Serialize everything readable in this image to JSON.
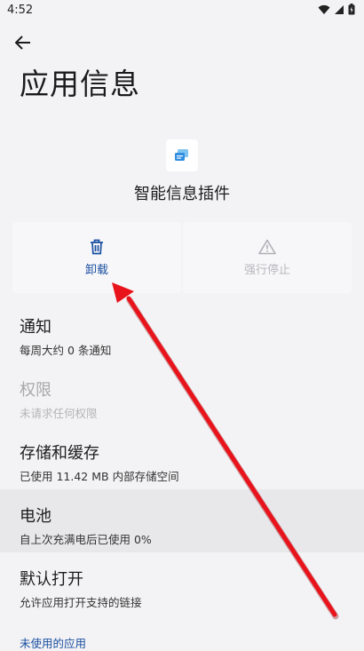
{
  "status": {
    "time": "4:52"
  },
  "header": {
    "title": "应用信息"
  },
  "app": {
    "name": "智能信息插件",
    "icon": "chat-bubbles-icon"
  },
  "actions": {
    "uninstall": {
      "label": "卸载",
      "icon": "trash-icon"
    },
    "force_stop": {
      "label": "强行停止",
      "icon": "warning-icon"
    }
  },
  "settings": {
    "items": [
      {
        "title": "通知",
        "subtitle": "每周大约 0 条通知"
      },
      {
        "title": "权限",
        "subtitle": "未请求任何权限"
      },
      {
        "title": "存储和缓存",
        "subtitle": "已使用 11.42 MB 内部存储空间"
      },
      {
        "title": "电池",
        "subtitle": "自上次充满电后已使用 0%"
      },
      {
        "title": "默认打开",
        "subtitle": "允许应用打开支持的链接"
      }
    ]
  },
  "section": {
    "unused_apps": "未使用的应用"
  },
  "colors": {
    "accent": "#1a4fa0",
    "annotation_arrow": "#e8131b"
  }
}
